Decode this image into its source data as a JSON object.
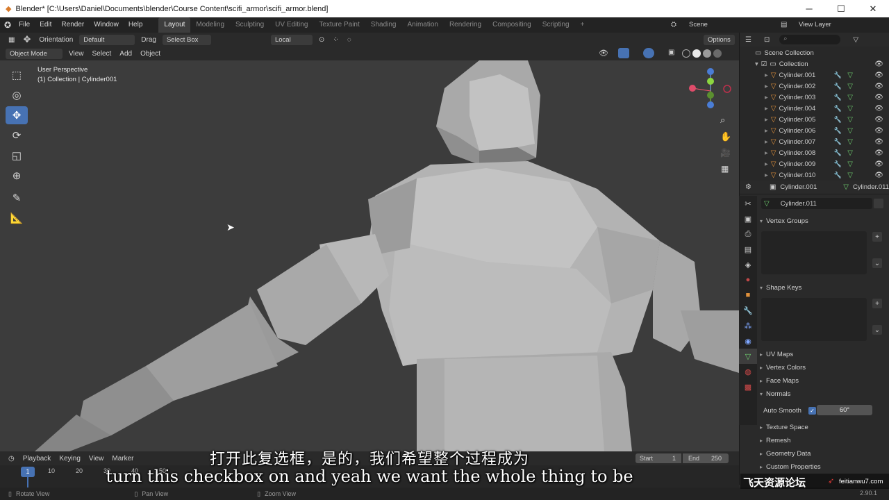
{
  "window": {
    "title": "Blender* [C:\\Users\\Daniel\\Documents\\blender\\Course Content\\scifi_armor\\scifi_armor.blend]",
    "minimize": "─",
    "maximize": "☐",
    "close": "✕"
  },
  "topbar": {
    "menus": [
      "File",
      "Edit",
      "Render",
      "Window",
      "Help"
    ],
    "workspaces": [
      "Layout",
      "Modeling",
      "Sculpting",
      "UV Editing",
      "Texture Paint",
      "Shading",
      "Animation",
      "Rendering",
      "Compositing",
      "Scripting"
    ],
    "active_workspace": "Layout",
    "add_tab": "+",
    "scene": "Scene",
    "view_layer": "View Layer"
  },
  "tool_header": {
    "orientation_label": "Orientation",
    "orientation_value": "Default",
    "drag_label": "Drag",
    "drag_value": "Select Box",
    "transform_space": "Local",
    "options": "Options"
  },
  "viewport_header": {
    "mode": "Object Mode",
    "menus": [
      "View",
      "Select",
      "Add",
      "Object"
    ]
  },
  "viewport": {
    "perspective": "User Perspective",
    "collection_info": "(1) Collection | Cylinder001"
  },
  "outliner": {
    "scene_collection": "Scene Collection",
    "collection": "Collection",
    "objects": [
      "Cylinder.001",
      "Cylinder.002",
      "Cylinder.003",
      "Cylinder.004",
      "Cylinder.005",
      "Cylinder.006",
      "Cylinder.007",
      "Cylinder.008",
      "Cylinder.009",
      "Cylinder.010"
    ]
  },
  "properties": {
    "object_name": "Cylinder.001",
    "mesh_name": "Cylinder.011",
    "data_name": "Cylinder.011",
    "panels": {
      "vertex_groups": "Vertex Groups",
      "shape_keys": "Shape Keys",
      "uv_maps": "UV Maps",
      "vertex_colors": "Vertex Colors",
      "face_maps": "Face Maps",
      "normals": "Normals",
      "auto_smooth": "Auto Smooth",
      "auto_smooth_angle": "60°",
      "texture_space": "Texture Space",
      "remesh": "Remesh",
      "geometry_data": "Geometry Data",
      "custom_properties": "Custom Properties"
    }
  },
  "timeline": {
    "menus": [
      "Playback",
      "Keying",
      "View",
      "Marker"
    ],
    "start_label": "Start",
    "start": "1",
    "end_label": "End",
    "end": "250",
    "current_frame": "1",
    "ticks": [
      "10",
      "20",
      "30",
      "40",
      "50"
    ]
  },
  "statusbar": {
    "rotate": "Rotate View",
    "pan": "Pan View",
    "zoom": "Zoom View",
    "version": "2.90.1"
  },
  "subtitles": {
    "chinese": "打开此复选框，是的，我们希望整个过程成为",
    "english": "turn this checkbox on and yeah we want the whole thing to be"
  },
  "watermark": {
    "text": "飞天资源论坛",
    "url": "feitianwu7.com"
  },
  "colors": {
    "accent": "#4772b3",
    "object_orange": "#e0913b",
    "mesh_green": "#6fcf6f"
  }
}
